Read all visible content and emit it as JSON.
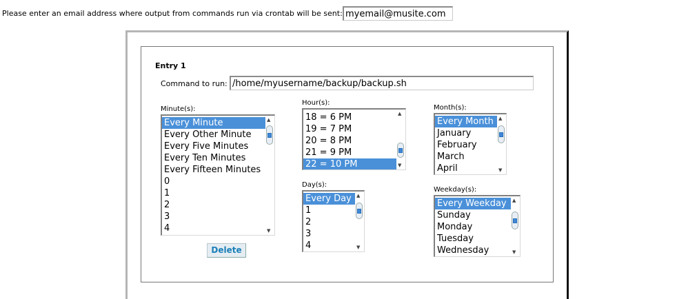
{
  "email_prompt": "Please enter an email address where output from commands run via crontab will be sent:",
  "email_value": "myemail@musite.com",
  "entry": {
    "title": "Entry 1",
    "command_label": "Command to run:",
    "command_value": "/home/myusername/backup/backup.sh",
    "minutes": {
      "label": "Minute(s):",
      "options": [
        "Every Minute",
        "Every Other Minute",
        "Every Five Minutes",
        "Every Ten Minutes",
        "Every Fifteen Minutes",
        "0",
        "1",
        "2",
        "3",
        "4"
      ],
      "selected": "Every Minute"
    },
    "hours": {
      "label": "Hour(s):",
      "options": [
        "18 = 6 PM",
        "19 = 7 PM",
        "20 = 8 PM",
        "21 = 9 PM",
        "22 = 10 PM"
      ],
      "selected": "22 = 10 PM"
    },
    "months": {
      "label": "Month(s):",
      "options": [
        "Every Month",
        "January",
        "February",
        "March",
        "April"
      ],
      "selected": "Every Month"
    },
    "days": {
      "label": "Day(s):",
      "options": [
        "Every Day",
        "1",
        "2",
        "3",
        "4"
      ],
      "selected": "Every Day"
    },
    "weekdays": {
      "label": "Weekday(s):",
      "options": [
        "Every Weekday",
        "Sunday",
        "Monday",
        "Tuesday",
        "Wednesday"
      ],
      "selected": "Every Weekday"
    },
    "delete_label": "Delete"
  },
  "colors": {
    "selection": "#4a90d9",
    "button_text": "#1a7fb8"
  }
}
